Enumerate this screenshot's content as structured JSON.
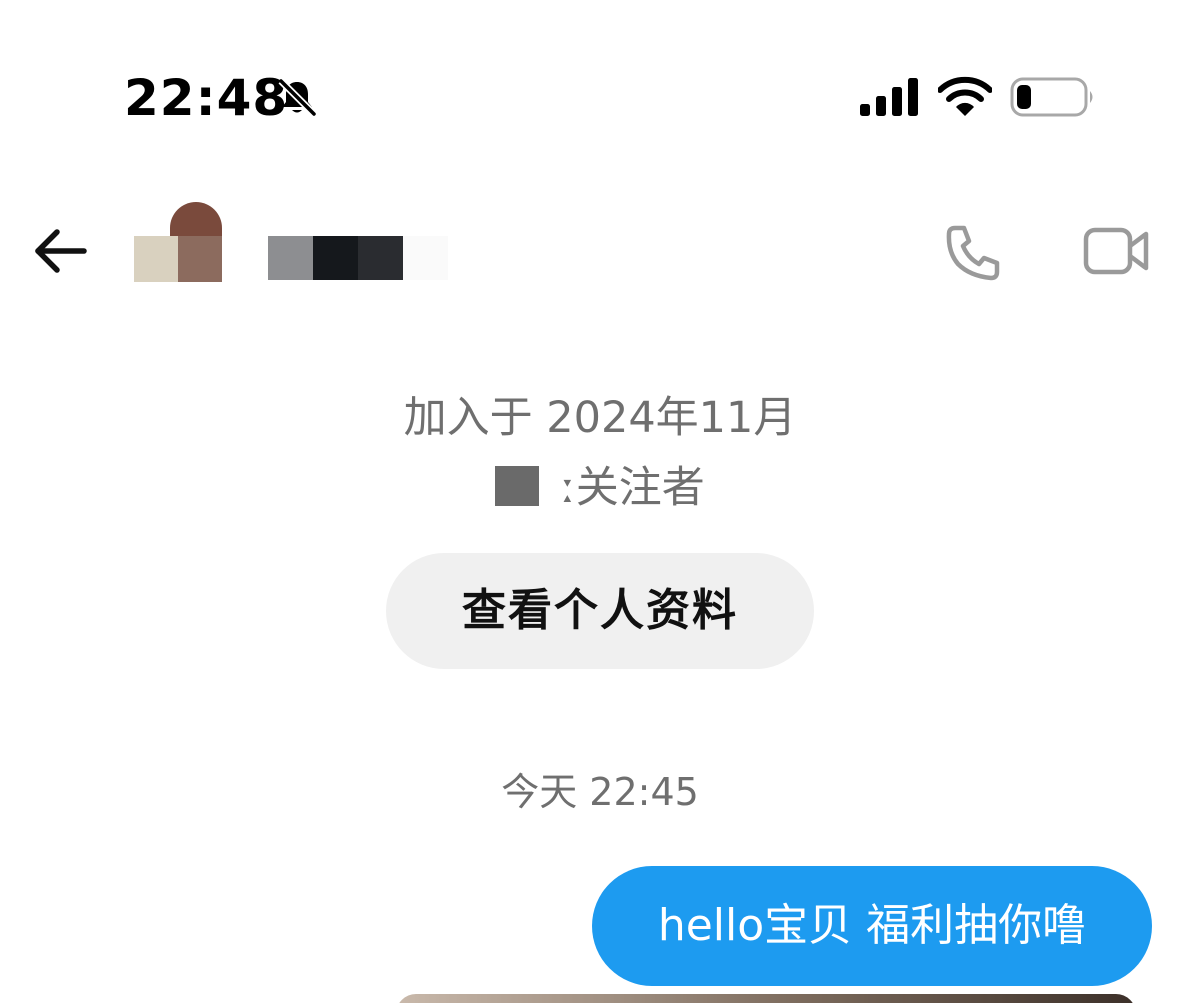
{
  "status_bar": {
    "time": "22:48",
    "icons": [
      "bell-slash-icon",
      "cellular-signal-icon",
      "wifi-icon",
      "battery-icon"
    ]
  },
  "header": {
    "back_icon": "arrow-left-icon",
    "call_icon": "phone-icon",
    "video_icon": "video-camera-icon",
    "avatar_redacted": true,
    "name_redacted": true
  },
  "profile_summary": {
    "joined": "加入于 2024年11月",
    "followers_suffix": "ː关注者",
    "view_profile_label": "查看个人资料"
  },
  "messages": {
    "timestamp": "今天 22:45",
    "items": [
      {
        "direction": "outgoing",
        "text": "hello宝贝 福利抽你噜"
      },
      {
        "direction": "outgoing",
        "type": "image"
      }
    ]
  },
  "colors": {
    "accent": "#1d9bf0",
    "secondary_text": "#6f6f6f",
    "button_bg": "#f0f0f0",
    "icon_gray": "#9a9a9a"
  }
}
